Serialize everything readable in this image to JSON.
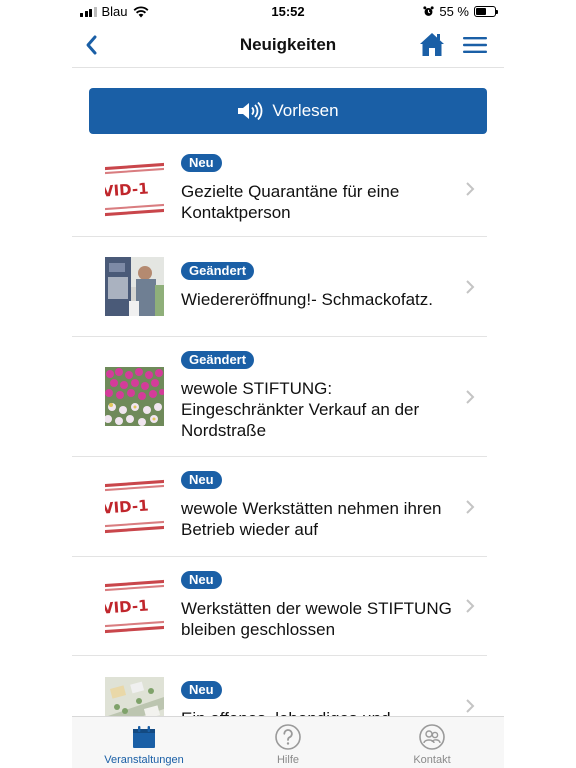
{
  "status_bar": {
    "carrier": "Blau",
    "time": "15:52",
    "battery": "55 %",
    "battery_level": 0.55
  },
  "nav": {
    "title": "Neuigkeiten"
  },
  "read_button": {
    "label": "Vorlesen"
  },
  "news": [
    {
      "badge": "Neu",
      "title": "Gezielte Quarantäne für eine Kontaktperson",
      "thumb": "covid-19-stamp",
      "stamp_text": "VID-1"
    },
    {
      "badge": "Geändert",
      "title": "Wiedereröffnung!- Schmackofatz.",
      "thumb": "restaurant-photo"
    },
    {
      "badge": "Geändert",
      "title": "wewole STIFTUNG: Eingeschränkter Verkauf an der Nordstraße",
      "thumb": "flowers-photo"
    },
    {
      "badge": "Neu",
      "title": "wewole Werkstätten nehmen ihren Betrieb wieder auf",
      "thumb": "covid-19-stamp",
      "stamp_text": "VID-1"
    },
    {
      "badge": "Neu",
      "title": "Werkstätten der wewole STIFTUNG bleiben geschlossen",
      "thumb": "covid-19-stamp",
      "stamp_text": "VID-1"
    },
    {
      "badge": "Neu",
      "title": "Ein offenes, lebendiges und",
      "thumb": "site-plan"
    }
  ],
  "tabs": [
    {
      "label": "Veranstaltungen",
      "icon": "calendar-icon",
      "active": true
    },
    {
      "label": "Hilfe",
      "icon": "help-icon",
      "active": false
    },
    {
      "label": "Kontakt",
      "icon": "contact-icon",
      "active": false
    }
  ],
  "colors": {
    "accent": "#1a5fa6",
    "stamp_red": "#c0262c"
  }
}
